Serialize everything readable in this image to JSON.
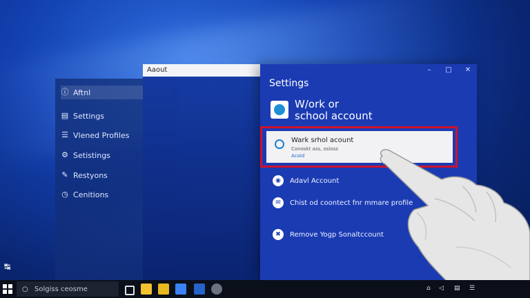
{
  "desktop": {
    "corner_glyph": "↹"
  },
  "side_panel": {
    "items": [
      {
        "label": "Aftnl",
        "icon": "info-icon",
        "glyph": "ⓘ",
        "active": true
      },
      {
        "label": "Settings",
        "icon": "settings-list-icon",
        "glyph": "▤"
      },
      {
        "label": "Vlened Profiles",
        "icon": "profiles-icon",
        "glyph": "☰"
      },
      {
        "label": "Setistings",
        "icon": "settings-gear-icon",
        "glyph": "⚙"
      },
      {
        "label": "Restyons",
        "icon": "pen-icon",
        "glyph": "✎"
      },
      {
        "label": "Cenitions",
        "icon": "clock-icon",
        "glyph": "◷"
      }
    ]
  },
  "about_window": {
    "title": "Aaout"
  },
  "settings_window": {
    "heading": "Settings",
    "controls": {
      "minimize": "–",
      "maximize": "□",
      "close": "✕"
    },
    "account_title_line1": "W/ork or",
    "account_title_line2": "school account",
    "highlighted_option": {
      "title": "Wark srhol acount",
      "subtitle": "Conoskt ass, osloss",
      "link": "Acoid"
    },
    "options": [
      {
        "label": "Adavl Account",
        "icon": "account-badge-icon",
        "glyph": "◉"
      },
      {
        "label": "Chist od coontect fnr mmare profile",
        "icon": "mail-icon",
        "glyph": "✉"
      },
      {
        "label": "Remove Yogp Sonaltccount",
        "icon": "remove-account-icon",
        "glyph": "✖"
      }
    ]
  },
  "taskbar": {
    "search_text": "Solgiss ceosme",
    "tray_icons": [
      "⌂",
      "◁",
      "▤",
      "☰"
    ]
  },
  "colors": {
    "settings_bg": "#1b3bb3",
    "highlight_border": "#d0122c",
    "taskbar_bg": "#0b0f1a"
  }
}
